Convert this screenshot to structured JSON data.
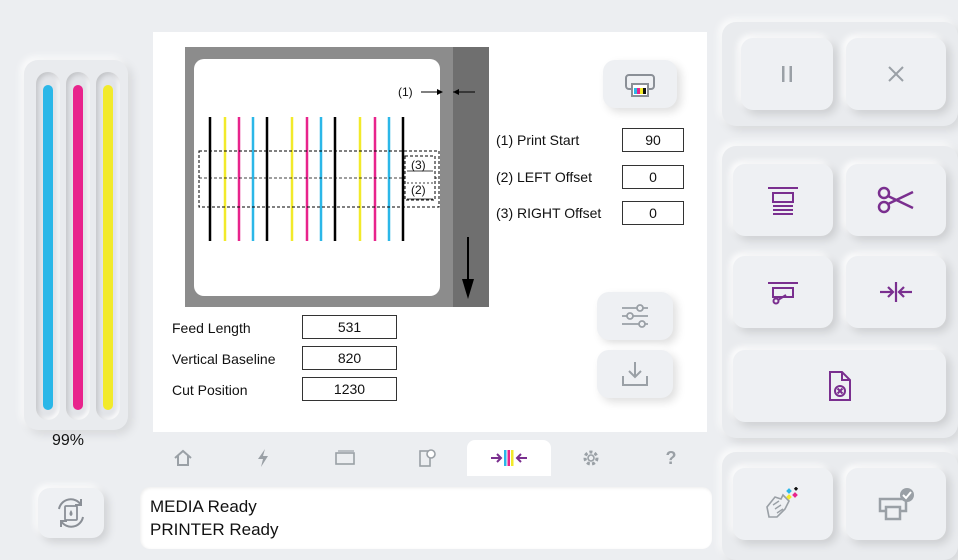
{
  "ink": {
    "level_label": "99%",
    "cartridges": [
      {
        "name": "cyan",
        "color": "#2bb7e8",
        "level": 0.99
      },
      {
        "name": "magenta",
        "color": "#e8248c",
        "level": 0.99
      },
      {
        "name": "yellow",
        "color": "#f2ea2a",
        "level": 0.99
      }
    ]
  },
  "preview": {
    "print_start_marker": "(1)",
    "right_offset_marker": "(3)",
    "left_offset_marker": "(2)"
  },
  "offsets": {
    "print_start": {
      "label": "(1) Print Start",
      "value": "90"
    },
    "left_offset": {
      "label": "(2) LEFT Offset",
      "value": "0"
    },
    "right_offset": {
      "label": "(3) RIGHT Offset",
      "value": "0"
    }
  },
  "feed": {
    "feed_length": {
      "label": "Feed Length",
      "value": "531"
    },
    "vertical_baseline": {
      "label": "Vertical Baseline",
      "value": "820"
    },
    "cut_position": {
      "label": "Cut Position",
      "value": "1230"
    }
  },
  "tabs": [
    {
      "icon": "home-icon"
    },
    {
      "icon": "lightning-icon"
    },
    {
      "icon": "media-icon"
    },
    {
      "icon": "roll-icon"
    },
    {
      "icon": "align-icon",
      "active": true
    },
    {
      "icon": "gear-icon"
    },
    {
      "icon": "help-icon",
      "text": "?"
    }
  ],
  "status": {
    "line1": "MEDIA Ready",
    "line2": "PRINTER Ready"
  },
  "colors": {
    "accent": "#7a2f8f",
    "icon_gray": "#9aa0a6"
  }
}
